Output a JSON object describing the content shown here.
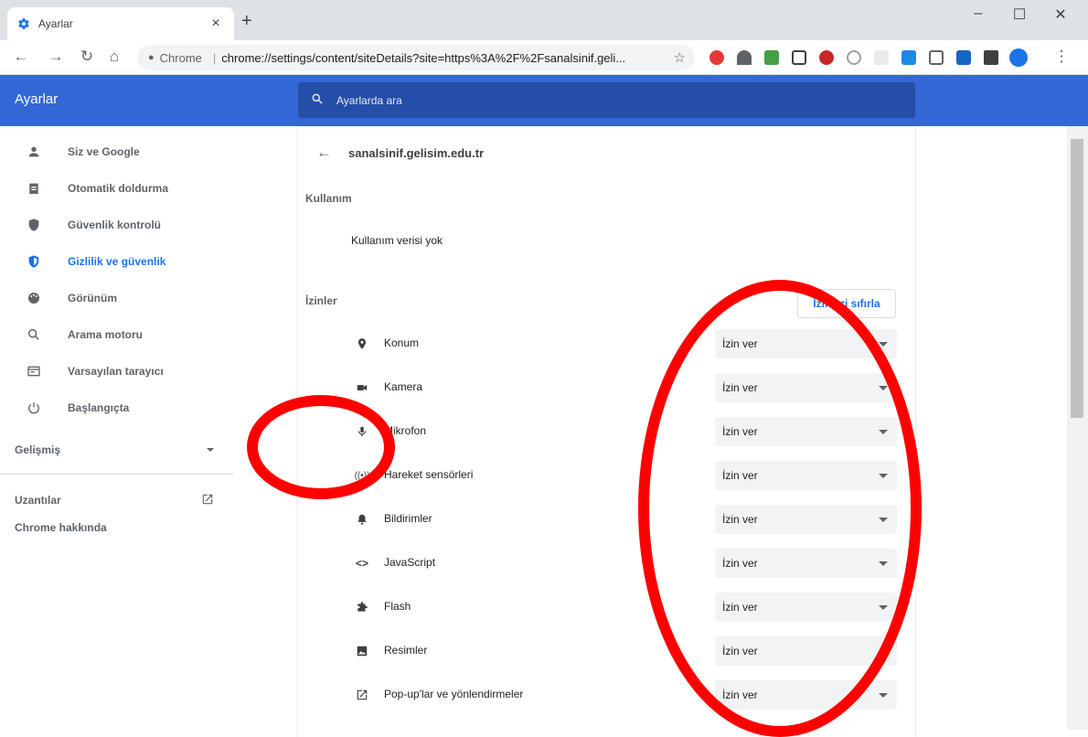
{
  "tab": {
    "title": "Ayarlar"
  },
  "omnibox": {
    "chip": "Chrome",
    "url": "chrome://settings/content/siteDetails?site=https%3A%2F%2Fsanalsinif.geli..."
  },
  "app": {
    "title": "Ayarlar",
    "search_placeholder": "Ayarlarda ara"
  },
  "sidebar": {
    "items": [
      {
        "label": "Siz ve Google",
        "icon": "person-icon"
      },
      {
        "label": "Otomatik doldurma",
        "icon": "clipboard-icon"
      },
      {
        "label": "Güvenlik kontrolü",
        "icon": "shield-check-icon"
      },
      {
        "label": "Gizlilik ve güvenlik",
        "icon": "privacy-shield-icon",
        "active": true
      },
      {
        "label": "Görünüm",
        "icon": "palette-icon"
      },
      {
        "label": "Arama motoru",
        "icon": "search-icon"
      },
      {
        "label": "Varsayılan tarayıcı",
        "icon": "browser-icon"
      },
      {
        "label": "Başlangıçta",
        "icon": "power-icon"
      }
    ],
    "advanced": "Gelişmiş",
    "extensions": "Uzantılar",
    "about": "Chrome hakkında"
  },
  "site": {
    "host": "sanalsinif.gelisim.edu.tr"
  },
  "usage": {
    "label": "Kullanım",
    "value": "Kullanım verisi yok"
  },
  "permissions": {
    "label": "İzinler",
    "reset": "İzinleri sıfırla",
    "items": [
      {
        "label": "Konum",
        "value": "İzin ver",
        "icon": "location-icon"
      },
      {
        "label": "Kamera",
        "value": "İzin ver",
        "icon": "camera-icon"
      },
      {
        "label": "Mikrofon",
        "value": "İzin ver",
        "icon": "microphone-icon"
      },
      {
        "label": "Hareket sensörleri",
        "value": "İzin ver",
        "icon": "sensors-icon"
      },
      {
        "label": "Bildirimler",
        "value": "İzin ver",
        "icon": "bell-icon"
      },
      {
        "label": "JavaScript",
        "value": "İzin ver",
        "icon": "code-icon"
      },
      {
        "label": "Flash",
        "value": "İzin ver",
        "icon": "puzzle-icon"
      },
      {
        "label": "Resimler",
        "value": "İzin ver",
        "icon": "image-icon"
      },
      {
        "label": "Pop-up'lar ve yönlendirmeler",
        "value": "İzin ver",
        "icon": "open-in-new-icon"
      }
    ]
  },
  "colors": {
    "appbar": "#3367d6",
    "accent": "#1a73e8",
    "annotation": "#ff0000"
  }
}
